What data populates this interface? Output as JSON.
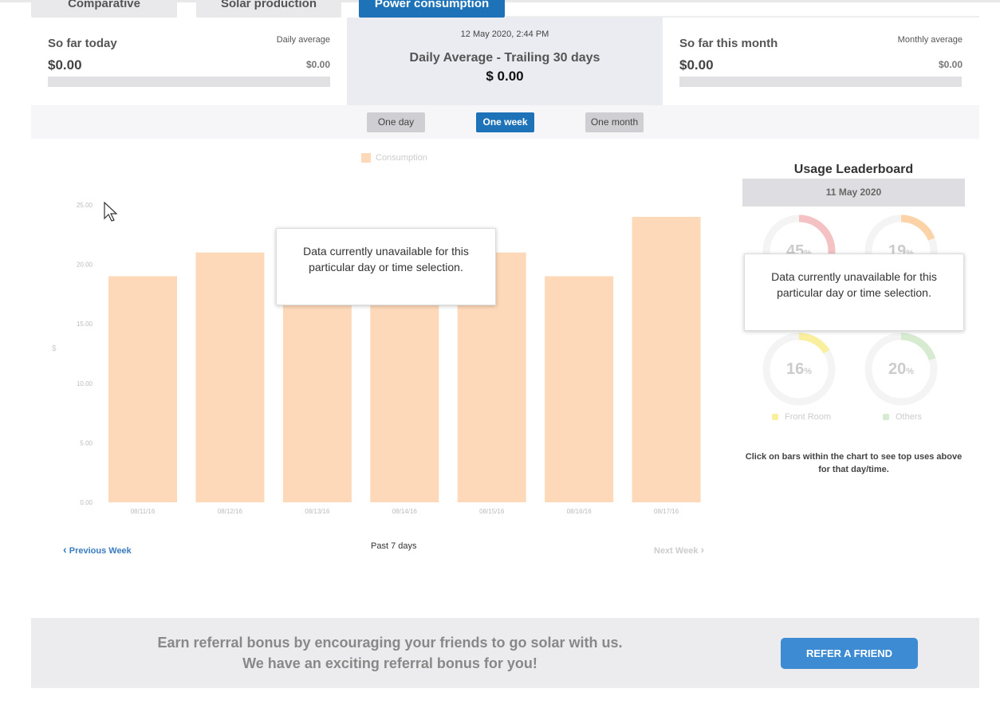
{
  "tabs": [
    {
      "label": "Comparative",
      "active": false
    },
    {
      "label": "Solar production",
      "active": false
    },
    {
      "label": "Power consumption",
      "active": true
    }
  ],
  "summary": {
    "today": {
      "label": "So far today",
      "value": "$0.00",
      "avg_label": "Daily average",
      "avg_value": "$0.00"
    },
    "center": {
      "timestamp": "12 May 2020, 2:44 PM",
      "title": "Daily Average - Trailing 30 days",
      "amount": "$ 0.00"
    },
    "month": {
      "label": "So far this month",
      "value": "$0.00",
      "avg_label": "Monthly average",
      "avg_value": "$0.00"
    }
  },
  "range": {
    "one_day": "One day",
    "one_week": "One week",
    "one_month": "One month",
    "selected": "One week"
  },
  "chart_data": {
    "type": "bar",
    "legend": [
      "Consumption"
    ],
    "categories": [
      "08/11/16",
      "08/12/16",
      "08/13/16",
      "08/14/16",
      "08/15/16",
      "08/16/16",
      "08/17/16"
    ],
    "values": [
      19,
      21,
      17,
      17,
      21,
      19,
      24
    ],
    "ylabel": "$",
    "yticks": [
      "0.00",
      "5.00",
      "10.00",
      "15.00",
      "20.00",
      "25.00"
    ],
    "ylim": [
      0,
      25
    ],
    "bar_color": "#fdd9b9",
    "legend_position": "top-center"
  },
  "tooltip_text": "Data currently unavailable for this particular day or time selection.",
  "pager": {
    "prev": "Previous Week",
    "mid": "Past 7 days",
    "next": "Next Week"
  },
  "leaderboard": {
    "title": "Usage Leaderboard",
    "date": "11 May 2020",
    "donuts": [
      {
        "value": "45",
        "unit": "%",
        "fraction": 0.45,
        "color": "#f4c2c2"
      },
      {
        "value": "19",
        "unit": "%",
        "fraction": 0.19,
        "color": "#fbd3a6"
      },
      {
        "value": "16",
        "unit": "%",
        "fraction": 0.16,
        "color": "#f9ef9f"
      },
      {
        "value": "20",
        "unit": "%",
        "fraction": 0.2,
        "color": "#d6ebcf"
      }
    ],
    "legend_front_room": "Front Room",
    "legend_others": "Others",
    "front_room_color": "#f9ef9f",
    "others_color": "#d6ebcf",
    "tooltip_text": "Data currently unavailable for this particular day or time selection.",
    "note": "Click on bars within the chart to see top uses above for that day/time."
  },
  "referral": {
    "line1": "Earn referral bonus by encouraging your friends to go solar with us.",
    "line2": "We have an exciting referral bonus for you!",
    "button": "REFER A FRIEND"
  }
}
